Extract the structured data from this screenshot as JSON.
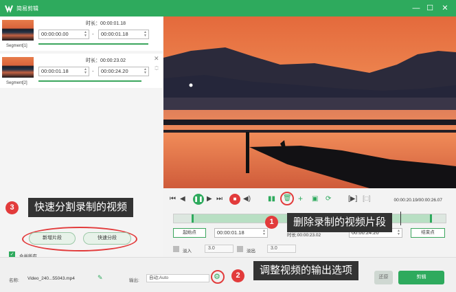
{
  "window": {
    "title": "简易剪辑",
    "minimize": "—",
    "maximize": "☐",
    "close": "✕"
  },
  "segments": [
    {
      "name": "Segment[1]",
      "duration_label": "时长：00:00:01.18",
      "start": "00:00:00.00",
      "end": "00:00:01.18",
      "dash": "-"
    },
    {
      "name": "Segment[2]",
      "duration_label": "时长：00:00:23.02",
      "start": "00:00:01.18",
      "end": "00:00:24.20",
      "dash": "-"
    }
  ],
  "callouts": {
    "c1": {
      "number": "1",
      "text": "删除录制的视频片段"
    },
    "c2": {
      "number": "2",
      "text": "调整视频的输出选项"
    },
    "c3": {
      "number": "3",
      "text": "快速分割录制的视频"
    }
  },
  "left_buttons": {
    "add_segment": "新增片段",
    "quick_split": "快速分段",
    "merge_all": "合并所有"
  },
  "player": {
    "timecode": "00:00:20.19/00:00:26.07"
  },
  "trim": {
    "start_btn": "起始点",
    "start_time": "00:00:01.18",
    "duration_label": "时长:00:00:23.02",
    "end_time": "00:00:24.20",
    "end_btn": "结束点"
  },
  "fade": {
    "fade_in_label": "淡入",
    "fade_in_value": "3.0",
    "fade_out_label": "淡出",
    "fade_out_value": "3.0"
  },
  "bottom": {
    "name_label": "名称:",
    "filename": "Video_240...55043.mp4",
    "output_label": "输出:",
    "output_value": "自动;Auto",
    "hidden_btn": "还原",
    "cut_btn": "剪辑"
  },
  "icons": [
    "app-logo-icon",
    "edit-icon",
    "gear-icon",
    "delete-icon",
    "play-icon",
    "stop-icon",
    "volume-icon"
  ]
}
